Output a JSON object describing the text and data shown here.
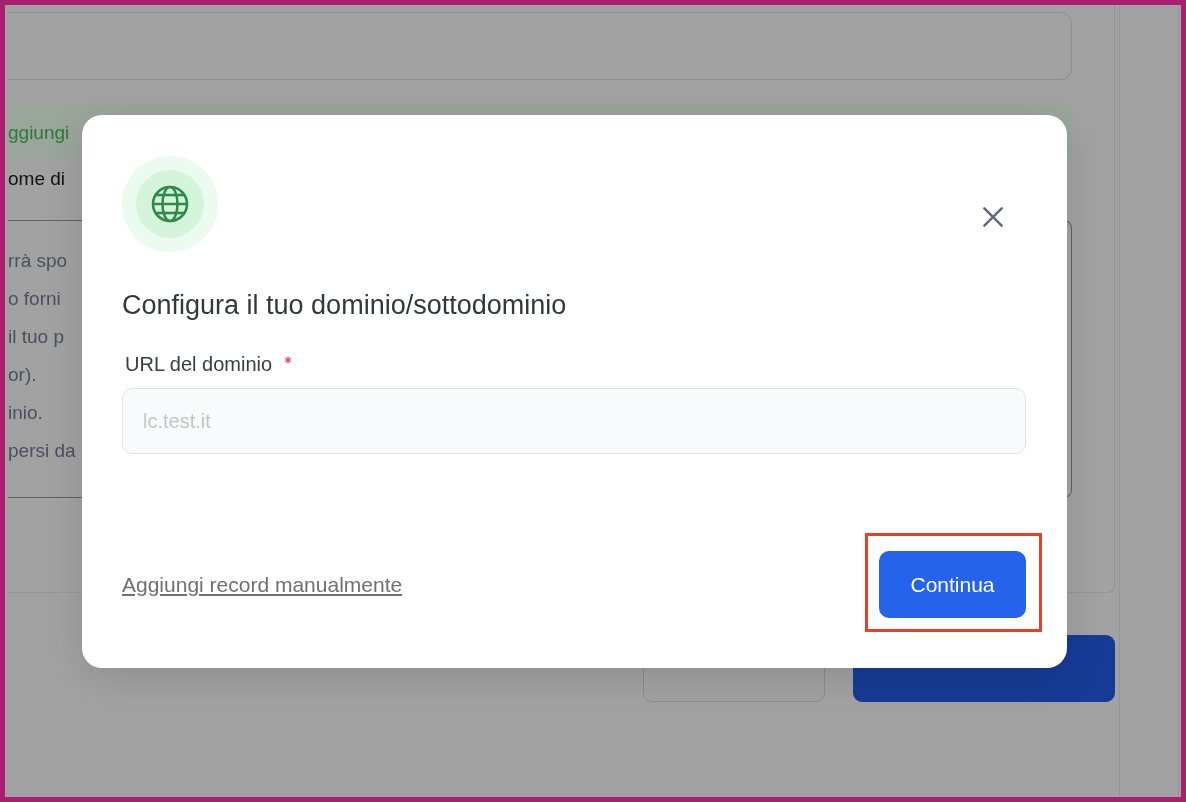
{
  "background": {
    "banner_text": "ggiungi",
    "section_label": "ome di",
    "description_lines": [
      "rrà spo",
      "o forni",
      "il tuo p",
      "or).",
      "inio.",
      "persi da"
    ],
    "buttons": [
      {
        "kind": "secondary"
      },
      {
        "kind": "primary"
      }
    ]
  },
  "dialog": {
    "title": "Configura il tuo dominio/sottodominio",
    "field": {
      "label": "URL del dominio",
      "required": true,
      "placeholder": "lc.test.it"
    },
    "link": "Aggiungi record manualmente",
    "primary_button": {
      "label": "Continua",
      "highlighted": true
    }
  }
}
